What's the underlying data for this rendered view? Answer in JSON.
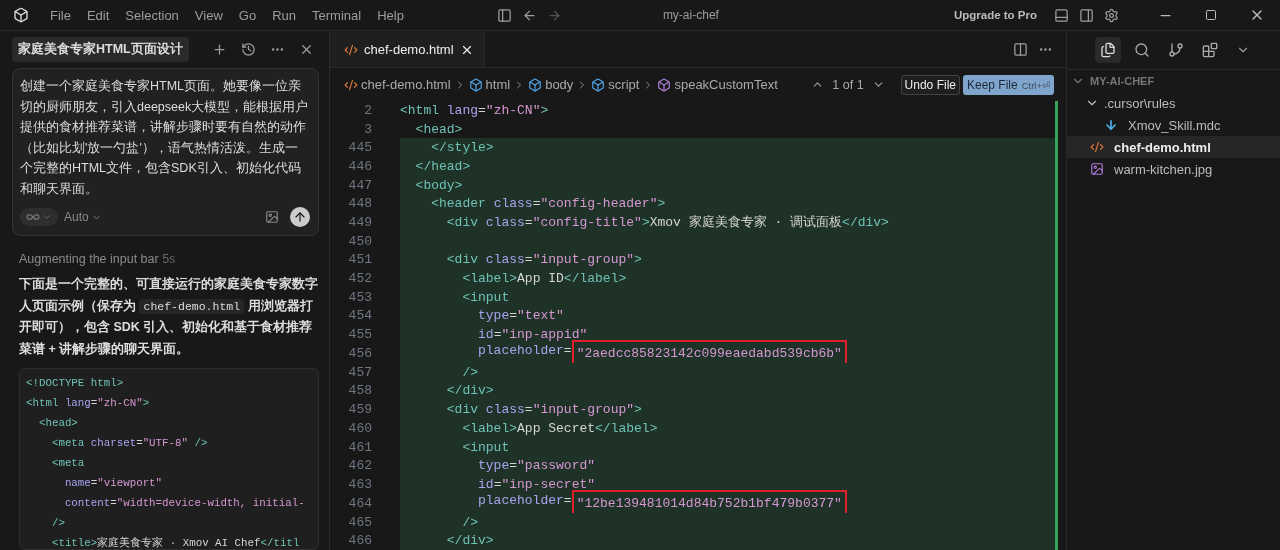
{
  "window": {
    "title": "my-ai-chef",
    "menu": [
      "File",
      "Edit",
      "Selection",
      "View",
      "Go",
      "Run",
      "Terminal",
      "Help"
    ],
    "upgrade": "Upgrade to Pro"
  },
  "chat": {
    "title": "家庭美食专家HTML页面设计",
    "prompt": "创建一个家庭美食专家HTML页面。她要像一位亲切的厨师朋友，引入deepseek大模型，能根据用户提供的食材推荐菜谱，讲解步骤时要有自然的动作（比如比划'放一勺盐'），语气热情活泼。生成一个完整的HTML文件，包含SDK引入、初始化代码和聊天界面。",
    "model": "Auto",
    "status": {
      "text": "Augmenting the input bar",
      "time": "5s"
    },
    "reply": [
      {
        "kind": "text",
        "text": "下面是一个完整的、可直接运行的家庭美食专家数字人页面示例（保存为 "
      },
      {
        "kind": "code",
        "text": "chef-demo.html"
      },
      {
        "kind": "text",
        "text": " 用浏览器打开即可），包含 SDK 引入、初始化和基于食材推荐菜谱 + 讲解步骤的聊天界面。"
      }
    ],
    "code": [
      {
        "tokens": [
          {
            "kind": "tag",
            "text": "<!DOCTYPE html>"
          }
        ]
      },
      {
        "tokens": [
          {
            "kind": "tag",
            "text": "<html "
          },
          {
            "kind": "attr",
            "text": "lang"
          },
          {
            "kind": "punct",
            "text": "="
          },
          {
            "kind": "str",
            "text": "\"zh-CN\""
          },
          {
            "kind": "tag",
            "text": ">"
          }
        ]
      },
      {
        "tokens": [
          {
            "kind": "tag",
            "text": "  <head>"
          }
        ]
      },
      {
        "tokens": [
          {
            "kind": "tag",
            "text": "    <meta "
          },
          {
            "kind": "attr",
            "text": "charset"
          },
          {
            "kind": "punct",
            "text": "="
          },
          {
            "kind": "str",
            "text": "\"UTF-8\""
          },
          {
            "kind": "tag",
            "text": " />"
          }
        ]
      },
      {
        "tokens": [
          {
            "kind": "tag",
            "text": "    <meta"
          }
        ]
      },
      {
        "tokens": [
          {
            "kind": "attr",
            "text": "      name"
          },
          {
            "kind": "punct",
            "text": "="
          },
          {
            "kind": "str",
            "text": "\"viewport\""
          }
        ]
      },
      {
        "tokens": [
          {
            "kind": "attr",
            "text": "      content"
          },
          {
            "kind": "punct",
            "text": "="
          },
          {
            "kind": "str",
            "text": "\"width=device-width, initial-"
          }
        ]
      },
      {
        "tokens": [
          {
            "kind": "tag",
            "text": "    />"
          }
        ]
      },
      {
        "tokens": [
          {
            "kind": "tag",
            "text": "    <title>"
          },
          {
            "kind": "text",
            "text": "家庭美食专家 · Xmov AI Chef"
          },
          {
            "kind": "tag",
            "text": "</titl"
          }
        ]
      }
    ]
  },
  "editor": {
    "tabs": [
      {
        "label": "chef-demo.html",
        "selected": true
      }
    ],
    "breadcrumb": [
      {
        "kind": "file",
        "text": "chef-demo.html"
      },
      {
        "kind": "element",
        "text": "html"
      },
      {
        "kind": "element",
        "text": "body"
      },
      {
        "kind": "element",
        "text": "script"
      },
      {
        "kind": "method",
        "text": "speakCustomText"
      }
    ],
    "change_count": "1 of 1",
    "undo": "Undo File",
    "keep": "Keep File",
    "keep_shortcut": "Ctrl+⏎",
    "lines": [
      {
        "num": "2",
        "added": false,
        "tokens": [
          {
            "kind": "tag",
            "text": "<html "
          },
          {
            "kind": "attr",
            "text": "lang"
          },
          {
            "kind": "punct",
            "text": "="
          },
          {
            "kind": "str",
            "text": "\"zh-CN\""
          },
          {
            "kind": "tag",
            "text": ">"
          }
        ]
      },
      {
        "num": "3",
        "added": false,
        "tokens": [
          {
            "kind": "tag",
            "text": "  <head>"
          }
        ]
      },
      {
        "num": "445",
        "added": true,
        "tokens": [
          {
            "kind": "tag",
            "text": "    </style>"
          }
        ]
      },
      {
        "num": "446",
        "added": true,
        "tokens": [
          {
            "kind": "tag",
            "text": "  </head>"
          }
        ]
      },
      {
        "num": "447",
        "added": true,
        "tokens": [
          {
            "kind": "tag",
            "text": "  <body>"
          }
        ]
      },
      {
        "num": "448",
        "added": true,
        "tokens": [
          {
            "kind": "tag",
            "text": "    <header "
          },
          {
            "kind": "attr",
            "text": "class"
          },
          {
            "kind": "punct",
            "text": "="
          },
          {
            "kind": "str",
            "text": "\"config-header\""
          },
          {
            "kind": "tag",
            "text": ">"
          }
        ]
      },
      {
        "num": "449",
        "added": true,
        "tokens": [
          {
            "kind": "tag",
            "text": "      <div "
          },
          {
            "kind": "attr",
            "text": "class"
          },
          {
            "kind": "punct",
            "text": "="
          },
          {
            "kind": "str",
            "text": "\"config-title\""
          },
          {
            "kind": "tag",
            "text": ">"
          },
          {
            "kind": "text",
            "text": "Xmov 家庭美食专家 · 调试面板"
          },
          {
            "kind": "tag",
            "text": "</div>"
          }
        ]
      },
      {
        "num": "450",
        "added": true
      },
      {
        "num": "451",
        "added": true,
        "tokens": [
          {
            "kind": "tag",
            "text": "      <div "
          },
          {
            "kind": "attr",
            "text": "class"
          },
          {
            "kind": "punct",
            "text": "="
          },
          {
            "kind": "str",
            "text": "\"input-group\""
          },
          {
            "kind": "tag",
            "text": ">"
          }
        ]
      },
      {
        "num": "452",
        "added": true,
        "tokens": [
          {
            "kind": "tag",
            "text": "        <label>"
          },
          {
            "kind": "text",
            "text": "App ID"
          },
          {
            "kind": "tag",
            "text": "</label>"
          }
        ]
      },
      {
        "num": "453",
        "added": true,
        "tokens": [
          {
            "kind": "tag",
            "text": "        <input"
          }
        ]
      },
      {
        "num": "454",
        "added": true,
        "tokens": [
          {
            "kind": "attr",
            "text": "          type"
          },
          {
            "kind": "punct",
            "text": "="
          },
          {
            "kind": "str",
            "text": "\"text\""
          }
        ]
      },
      {
        "num": "455",
        "added": true,
        "tokens": [
          {
            "kind": "attr",
            "text": "          id"
          },
          {
            "kind": "punct",
            "text": "="
          },
          {
            "kind": "str",
            "text": "\"inp-appid\""
          }
        ]
      },
      {
        "num": "456",
        "added": true,
        "tokens": [
          {
            "kind": "attr",
            "text": "          placeholder"
          },
          {
            "kind": "punct",
            "text": "="
          },
          {
            "kind": "str",
            "text": "\"2aedcc85823142c099eaedabd539cb6b\"",
            "boxed": true
          }
        ]
      },
      {
        "num": "457",
        "added": true,
        "tokens": [
          {
            "kind": "tag",
            "text": "        />"
          }
        ]
      },
      {
        "num": "458",
        "added": true,
        "tokens": [
          {
            "kind": "tag",
            "text": "      </div>"
          }
        ]
      },
      {
        "num": "459",
        "added": true,
        "tokens": [
          {
            "kind": "tag",
            "text": "      <div "
          },
          {
            "kind": "attr",
            "text": "class"
          },
          {
            "kind": "punct",
            "text": "="
          },
          {
            "kind": "str",
            "text": "\"input-group\""
          },
          {
            "kind": "tag",
            "text": ">"
          }
        ]
      },
      {
        "num": "460",
        "added": true,
        "tokens": [
          {
            "kind": "tag",
            "text": "        <label>"
          },
          {
            "kind": "text",
            "text": "App Secret"
          },
          {
            "kind": "tag",
            "text": "</label>"
          }
        ]
      },
      {
        "num": "461",
        "added": true,
        "tokens": [
          {
            "kind": "tag",
            "text": "        <input"
          }
        ]
      },
      {
        "num": "462",
        "added": true,
        "tokens": [
          {
            "kind": "attr",
            "text": "          type"
          },
          {
            "kind": "punct",
            "text": "="
          },
          {
            "kind": "str",
            "text": "\"password\""
          }
        ]
      },
      {
        "num": "463",
        "added": true,
        "tokens": [
          {
            "kind": "attr",
            "text": "          id"
          },
          {
            "kind": "punct",
            "text": "="
          },
          {
            "kind": "str",
            "text": "\"inp-secret\""
          }
        ]
      },
      {
        "num": "464",
        "added": true,
        "tokens": [
          {
            "kind": "attr",
            "text": "          placeholder"
          },
          {
            "kind": "punct",
            "text": "="
          },
          {
            "kind": "str",
            "text": "\"12be139481014d84b752b1bf479b0377\"",
            "boxed": true
          }
        ]
      },
      {
        "num": "465",
        "added": true,
        "tokens": [
          {
            "kind": "tag",
            "text": "        />"
          }
        ]
      },
      {
        "num": "466",
        "added": true,
        "tokens": [
          {
            "kind": "tag",
            "text": "      </div>"
          }
        ]
      }
    ]
  },
  "explorer": {
    "tools": [
      {
        "kind": "files",
        "selected": true
      },
      {
        "kind": "search",
        "selected": false
      },
      {
        "kind": "branch",
        "selected": false
      },
      {
        "kind": "extensions",
        "selected": false
      }
    ],
    "tree": [
      {
        "label": "MY-AI-CHEF",
        "kind": "root",
        "expanded": true,
        "selected": false,
        "children": [
          {
            "label": ".cursor\\rules",
            "kind": "folder",
            "expanded": true,
            "selected": false,
            "children": [
              {
                "label": "Xmov_Skill.mdc",
                "kind": "download",
                "selected": false
              }
            ]
          },
          {
            "label": "chef-demo.html",
            "kind": "html",
            "selected": true
          },
          {
            "label": "warm-kitchen.jpg",
            "kind": "image",
            "selected": false
          }
        ]
      }
    ]
  }
}
